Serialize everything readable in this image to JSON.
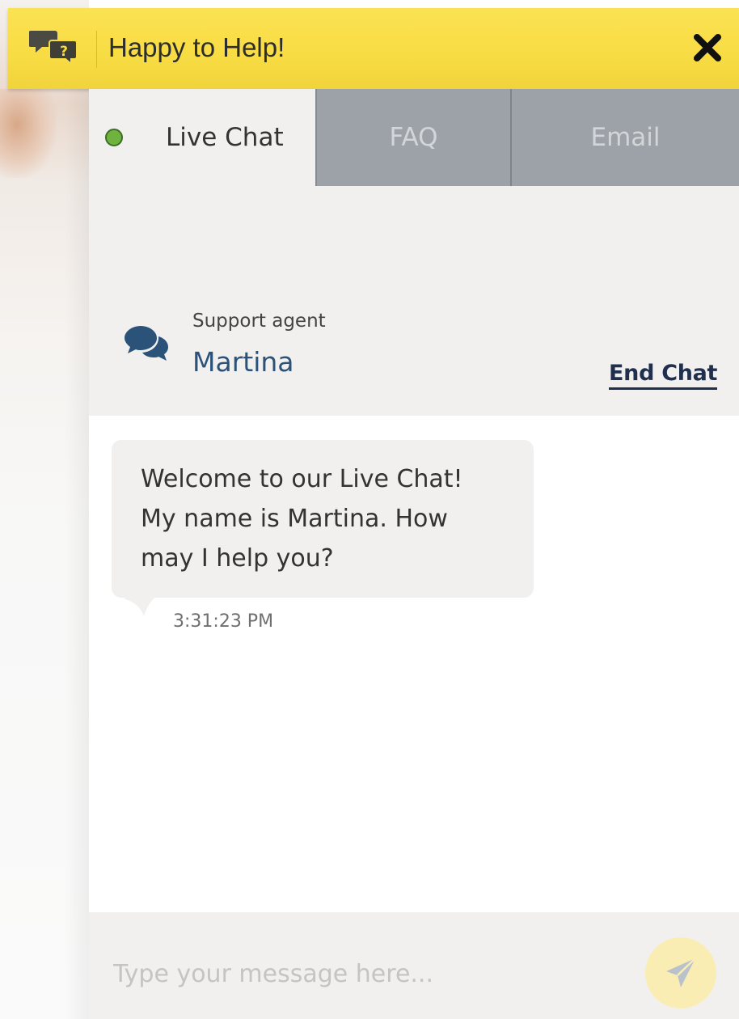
{
  "header": {
    "title": "Happy to Help!",
    "accent_color": "#f8dc43",
    "logo_icon": "chat-question-icon",
    "close_icon": "close-icon"
  },
  "tabs": [
    {
      "label": "Live Chat",
      "active": true,
      "status_color": "#6fb23e"
    },
    {
      "label": "FAQ",
      "active": false
    },
    {
      "label": "Email",
      "active": false
    }
  ],
  "agent": {
    "role": "Support agent",
    "name": "Martina",
    "icon": "chat-bubbles-icon",
    "end_chat_label": "End Chat"
  },
  "messages": [
    {
      "text": "Welcome to our Live Chat! My name is Martina. How may I help you?",
      "time": "3:31:23 PM"
    }
  ],
  "composer": {
    "placeholder": "Type your message here...",
    "send_icon": "send-icon"
  }
}
